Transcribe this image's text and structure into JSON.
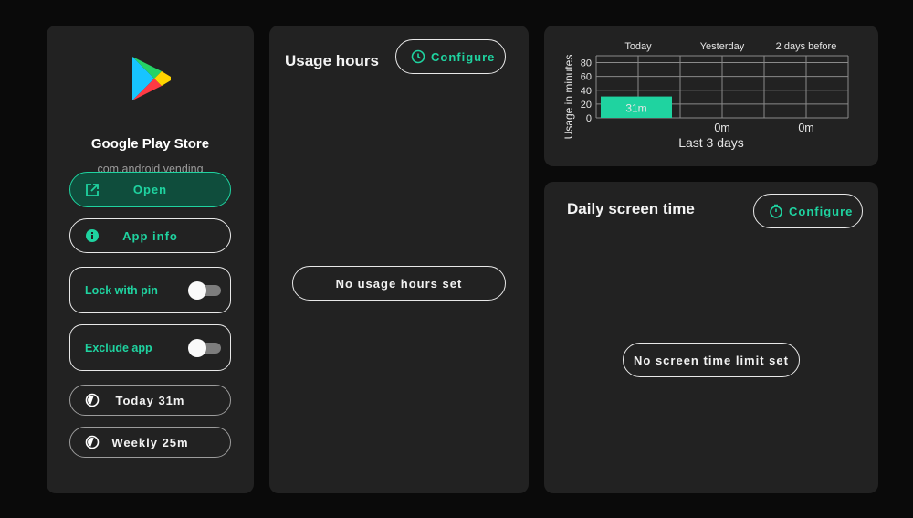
{
  "app": {
    "name": "Google Play Store",
    "package": "com.android.vending"
  },
  "actions": {
    "open_label": "Open",
    "app_info_label": "App info",
    "lock_label": "Lock with pin",
    "lock_enabled": false,
    "exclude_label": "Exclude app",
    "exclude_enabled": false
  },
  "stats": {
    "today_label": "Today 31m",
    "weekly_label": "Weekly 25m"
  },
  "usage_hours": {
    "title": "Usage hours",
    "configure_label": "Configure",
    "empty_label": "No usage hours set"
  },
  "screen_time": {
    "title": "Daily screen time",
    "configure_label": "Configure",
    "empty_label": "No screen time limit set"
  },
  "colors": {
    "accent": "#1fd3a0",
    "card": "#222222",
    "background": "#0a0a0a"
  },
  "chart_data": {
    "type": "bar",
    "categories": [
      "Today",
      "Yesterday",
      "2 days before"
    ],
    "values": [
      31,
      0,
      0
    ],
    "data_labels": [
      "31m",
      "0m",
      "0m"
    ],
    "ylabel": "Usage in minutes",
    "xlabel": "Last 3 days",
    "ylim": [
      0,
      90
    ],
    "yticks": [
      0,
      20,
      40,
      60,
      80
    ],
    "grid": true,
    "bar_color": "#1fd3a0"
  }
}
